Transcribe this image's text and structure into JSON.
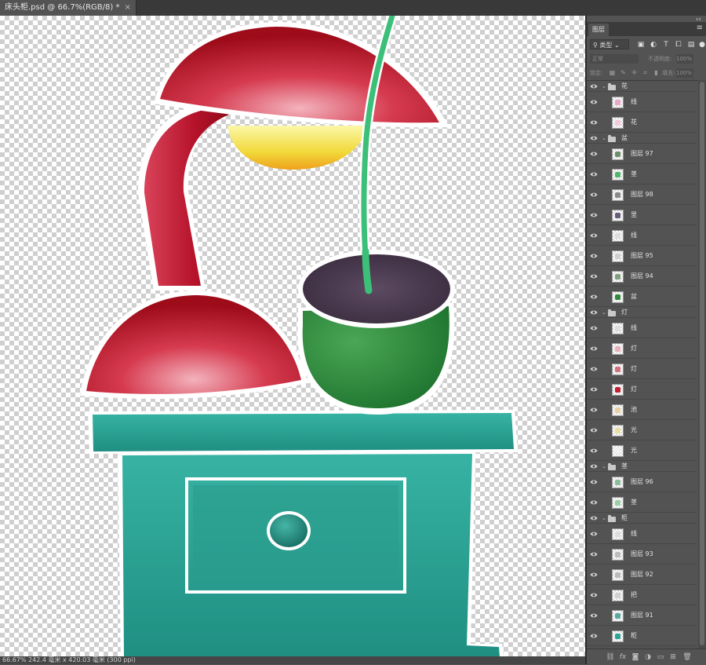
{
  "document": {
    "tab_title": "床头柜.psd @ 66.7%(RGB/8) *",
    "close_glyph": "×",
    "status": "66.67%  242.4 毫米 x 420.03 毫米 (300 ppi)"
  },
  "panel": {
    "collapse_glyph": "‹‹",
    "tab_label": "图层",
    "menu_glyph": "≡",
    "filter_label": "类型",
    "filter_icons": [
      "image-filter-icon",
      "adjustment-filter-icon",
      "type-filter-icon",
      "shape-filter-icon",
      "smart-object-filter-icon"
    ],
    "blend_mode": "正常",
    "opacity_label": "不透明度:",
    "opacity_value": "100%",
    "lock_label": "锁定:",
    "fill_label": "填充:",
    "fill_value": "100%",
    "bottom_icons": [
      "link-icon",
      "fx-icon",
      "mask-icon",
      "adjustment-icon",
      "group-icon",
      "new-layer-icon",
      "delete-icon"
    ]
  },
  "layers": [
    {
      "type": "group",
      "name": "花",
      "thumb": "folder"
    },
    {
      "type": "layer",
      "name": "线",
      "thumb": "#e8a6c8"
    },
    {
      "type": "layer",
      "name": "花",
      "thumb": "#f3c9dd"
    },
    {
      "type": "group",
      "name": "盆",
      "thumb": "folder"
    },
    {
      "type": "layer",
      "name": "图层 97",
      "thumb": "#6b8f6b"
    },
    {
      "type": "layer",
      "name": "茎",
      "thumb": "#4fb86a"
    },
    {
      "type": "layer",
      "name": "图层 98",
      "thumb": "#8a8a8a"
    },
    {
      "type": "layer",
      "name": "里",
      "thumb": "#6a5a7a"
    },
    {
      "type": "layer",
      "name": "线",
      "thumb": "#dddddd"
    },
    {
      "type": "layer",
      "name": "图层 95",
      "thumb": "#cfcfcf"
    },
    {
      "type": "layer",
      "name": "图层 94",
      "thumb": "#7fa07f"
    },
    {
      "type": "layer",
      "name": "盆",
      "thumb": "#2f8a3c"
    },
    {
      "type": "group",
      "name": "灯",
      "thumb": "folder"
    },
    {
      "type": "layer",
      "name": "线",
      "thumb": "#dddddd"
    },
    {
      "type": "layer",
      "name": "灯",
      "thumb": "#e9b0b8"
    },
    {
      "type": "layer",
      "name": "灯",
      "thumb": "#d46f7c"
    },
    {
      "type": "layer",
      "name": "灯",
      "thumb": "#c41f2e"
    },
    {
      "type": "layer",
      "name": "池",
      "thumb": "#e8d0a0"
    },
    {
      "type": "layer",
      "name": "光",
      "thumb": "#e8e0a0"
    },
    {
      "type": "layer",
      "name": "光",
      "thumb": "#f0f0f0"
    },
    {
      "type": "group",
      "name": "茎",
      "thumb": "folder"
    },
    {
      "type": "layer",
      "name": "图层 96",
      "thumb": "#8abf9a"
    },
    {
      "type": "layer",
      "name": "茎",
      "thumb": "#9acfa6"
    },
    {
      "type": "group",
      "name": "柜",
      "thumb": "folder"
    },
    {
      "type": "layer",
      "name": "线",
      "thumb": "#dddddd"
    },
    {
      "type": "layer",
      "name": "图层 93",
      "thumb": "#bcbcbc"
    },
    {
      "type": "layer",
      "name": "图层 92",
      "thumb": "#bcbcbc"
    },
    {
      "type": "layer",
      "name": "把",
      "thumb": "#d0d0d0"
    },
    {
      "type": "layer",
      "name": "图层 91",
      "thumb": "#5aa9a0"
    },
    {
      "type": "layer",
      "name": "柜",
      "thumb": "#2aa596"
    }
  ],
  "colors": {
    "lamp_red": "#b8101f",
    "lamp_highlight": "#e66b7b",
    "bulb_yellow": "#f3df4a",
    "bulb_orange": "#f0a21d",
    "stem_green": "#3cbf78",
    "pot_green": "#238a36",
    "soil": "#4a3a4e",
    "cabinet_teal": "#2aa596",
    "outline_white": "#ffffff"
  }
}
